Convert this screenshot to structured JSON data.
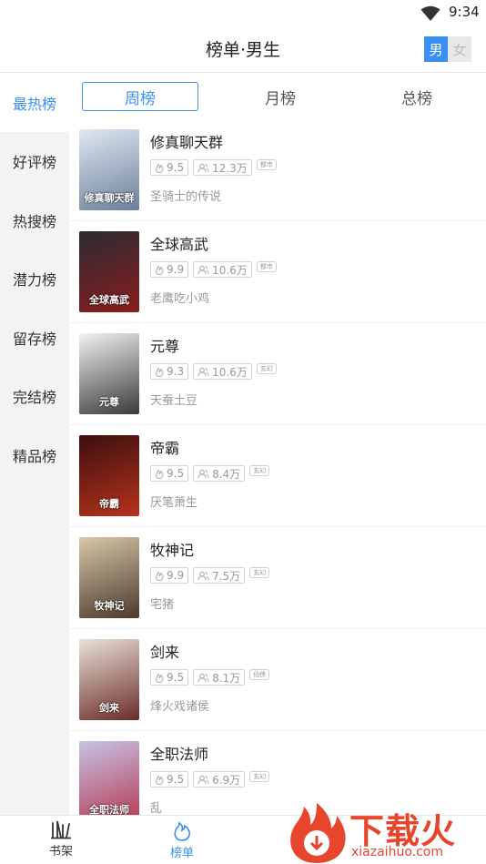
{
  "status_bar": {
    "time": "9:34"
  },
  "header": {
    "title": "榜单·男生",
    "gender_male": "男",
    "gender_female": "女"
  },
  "sidebar": {
    "items": [
      {
        "label": "最热榜",
        "active": true
      },
      {
        "label": "好评榜"
      },
      {
        "label": "热搜榜"
      },
      {
        "label": "潜力榜"
      },
      {
        "label": "留存榜"
      },
      {
        "label": "完结榜"
      },
      {
        "label": "精品榜"
      }
    ]
  },
  "tabs": [
    {
      "label": "周榜",
      "active": true
    },
    {
      "label": "月榜"
    },
    {
      "label": "总榜"
    }
  ],
  "books": [
    {
      "title": "修真聊天群",
      "score": "9.5",
      "readers": "12.3万",
      "tag": "都市",
      "author": "圣骑士的传说",
      "cover_colors": [
        "#dfe8f2",
        "#6d7f9b"
      ],
      "cover_text": "修真聊天群"
    },
    {
      "title": "全球高武",
      "score": "9.9",
      "readers": "10.6万",
      "tag": "都市",
      "author": "老鹰吃小鸡",
      "cover_colors": [
        "#2b2b33",
        "#8a1d1d"
      ],
      "cover_text": "全球高武"
    },
    {
      "title": "元尊",
      "score": "9.3",
      "readers": "10.6万",
      "tag": "玄幻",
      "author": "天蚕土豆",
      "cover_colors": [
        "#f2f2f2",
        "#3a3a3a"
      ],
      "cover_text": "元尊"
    },
    {
      "title": "帝霸",
      "score": "9.5",
      "readers": "8.4万",
      "tag": "玄幻",
      "author": "厌笔萧生",
      "cover_colors": [
        "#3b0f0f",
        "#b8321c"
      ],
      "cover_text": "帝霸"
    },
    {
      "title": "牧神记",
      "score": "9.9",
      "readers": "7.5万",
      "tag": "玄幻",
      "author": "宅猪",
      "cover_colors": [
        "#d8c7a8",
        "#4a3a2c"
      ],
      "cover_text": "牧神记"
    },
    {
      "title": "剑来",
      "score": "9.5",
      "readers": "8.1万",
      "tag": "仙侠",
      "author": "烽火戏诸侯",
      "cover_colors": [
        "#e9e2d6",
        "#6b2b2b"
      ],
      "cover_text": "剑来"
    },
    {
      "title": "全职法师",
      "score": "9.5",
      "readers": "6.9万",
      "tag": "玄幻",
      "author": "乱",
      "cover_colors": [
        "#c7c3e6",
        "#b43a52"
      ],
      "cover_text": "全职法师"
    }
  ],
  "bottom_nav": [
    {
      "label": "书架",
      "icon": "bookshelf-icon"
    },
    {
      "label": "榜单",
      "icon": "flame-icon",
      "active": true
    }
  ],
  "watermark": {
    "text": "下载火",
    "url": "xiazaihuo.com"
  },
  "colors": {
    "accent": "#3b8ff3",
    "watermark": "#e8452d"
  }
}
